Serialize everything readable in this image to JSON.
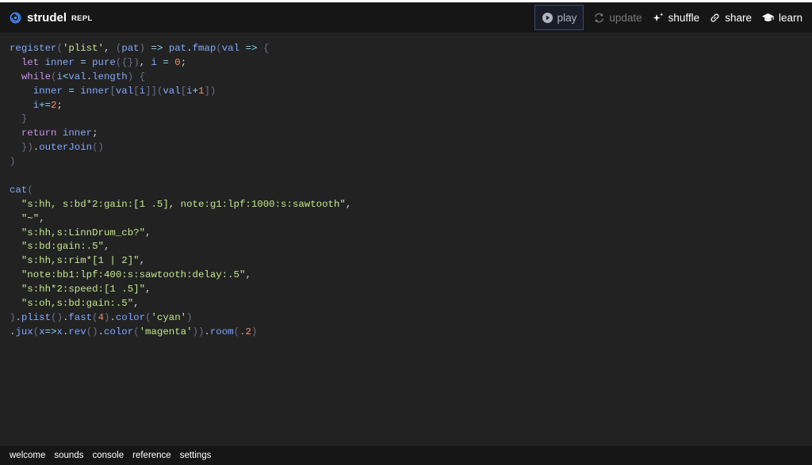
{
  "header": {
    "brand_name": "strudel",
    "brand_tag": "REPL",
    "actions": {
      "play": "play",
      "update": "update",
      "shuffle": "shuffle",
      "share": "share",
      "learn": "learn"
    }
  },
  "editor": {
    "lines": [
      "register('plist', (pat) => pat.fmap(val => {",
      "  let inner = pure({}), i = 0;",
      "  while(i<val.length) {",
      "    inner = inner[val[i]](val[i+1])",
      "    i+=2;",
      "  }",
      "  return inner;",
      "  }).outerJoin()",
      ")",
      "",
      "cat(",
      "  \"s:hh, s:bd*2:gain:[1 .5], note:g1:lpf:1000:s:sawtooth\",",
      "  \"~\",",
      "  \"s:hh,s:LinnDrum_cb?\",",
      "  \"s:bd:gain:.5\",",
      "  \"s:hh,s:rim*[1 | 2]\",",
      "  \"note:bb1:lpf:400:s:sawtooth:delay:.5\",",
      "  \"s:hh*2:speed:[1 .5]\",",
      "  \"s:oh,s:bd:gain:.5\",",
      ").plist().fast(4).color('cyan')",
      ".jux(x=>x.rev().color('magenta')).room(.2)"
    ]
  },
  "footer": {
    "tabs": [
      "welcome",
      "sounds",
      "console",
      "reference",
      "settings"
    ]
  },
  "colors": {
    "keyword": "#c792ea",
    "identifier": "#82aaff",
    "string": "#c3e88d",
    "number": "#f78c6c",
    "operator": "#89ddff",
    "background": "#222222",
    "header_background": "#161616"
  }
}
